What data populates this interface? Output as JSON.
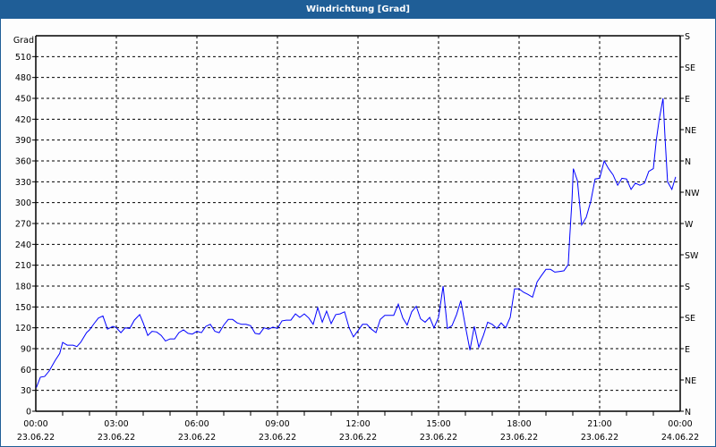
{
  "window": {
    "title": "Windrichtung [Grad]"
  },
  "chart_data": {
    "type": "line",
    "title": "Windrichtung [Grad]",
    "ylabel": "Grad",
    "ylim": [
      0,
      540
    ],
    "xlim_hours": [
      0,
      24
    ],
    "grid": true,
    "y_ticks": [
      0,
      30,
      60,
      90,
      120,
      150,
      180,
      210,
      240,
      270,
      300,
      330,
      360,
      390,
      420,
      450,
      480,
      510
    ],
    "right_ticks": [
      {
        "value": 0,
        "label": "N"
      },
      {
        "value": 45,
        "label": "NE"
      },
      {
        "value": 90,
        "label": "E"
      },
      {
        "value": 135,
        "label": "SE"
      },
      {
        "value": 180,
        "label": "S"
      },
      {
        "value": 225,
        "label": "SW"
      },
      {
        "value": 270,
        "label": "W"
      },
      {
        "value": 315,
        "label": "NW"
      },
      {
        "value": 360,
        "label": "N"
      },
      {
        "value": 405,
        "label": "NE"
      },
      {
        "value": 450,
        "label": "E"
      },
      {
        "value": 495,
        "label": "SE"
      },
      {
        "value": 540,
        "label": "S"
      }
    ],
    "x_ticks": [
      {
        "hour": 0,
        "time": "00:00",
        "date": "23.06.22"
      },
      {
        "hour": 3,
        "time": "03:00",
        "date": "23.06.22"
      },
      {
        "hour": 6,
        "time": "06:00",
        "date": "23.06.22"
      },
      {
        "hour": 9,
        "time": "09:00",
        "date": "23.06.22"
      },
      {
        "hour": 12,
        "time": "12:00",
        "date": "23.06.22"
      },
      {
        "hour": 15,
        "time": "15:00",
        "date": "23.06.22"
      },
      {
        "hour": 18,
        "time": "18:00",
        "date": "23.06.22"
      },
      {
        "hour": 21,
        "time": "21:00",
        "date": "23.06.22"
      },
      {
        "hour": 24,
        "time": "00:00",
        "date": "24.06.22"
      }
    ],
    "series": [
      {
        "name": "Windrichtung",
        "color": "#0000ff",
        "x_hours": [
          0.02,
          0.17,
          0.33,
          0.5,
          0.72,
          0.89,
          1.0,
          1.17,
          1.39,
          1.53,
          1.67,
          1.89,
          2.0,
          2.17,
          2.33,
          2.5,
          2.67,
          2.87,
          3.0,
          3.17,
          3.33,
          3.5,
          3.67,
          3.87,
          4.0,
          4.17,
          4.33,
          4.5,
          4.67,
          4.83,
          5.0,
          5.17,
          5.33,
          5.5,
          5.67,
          5.83,
          6.0,
          6.17,
          6.33,
          6.5,
          6.67,
          6.83,
          7.0,
          7.17,
          7.33,
          7.5,
          7.67,
          7.83,
          8.0,
          8.17,
          8.33,
          8.5,
          8.67,
          8.83,
          9.0,
          9.17,
          9.33,
          9.5,
          9.67,
          9.83,
          10.0,
          10.17,
          10.33,
          10.5,
          10.67,
          10.83,
          11.0,
          11.17,
          11.33,
          11.5,
          11.67,
          11.83,
          12.0,
          12.17,
          12.33,
          12.5,
          12.67,
          12.83,
          13.0,
          13.33,
          13.5,
          13.67,
          13.83,
          14.0,
          14.17,
          14.33,
          14.5,
          14.67,
          14.83,
          15.0,
          15.17,
          15.33,
          15.5,
          15.67,
          15.83,
          16.0,
          16.17,
          16.33,
          16.5,
          16.67,
          16.83,
          17.0,
          17.17,
          17.33,
          17.5,
          17.67,
          17.83,
          18.0,
          18.17,
          18.33,
          18.5,
          18.67,
          18.83,
          19.0,
          19.17,
          19.33,
          19.5,
          19.67,
          19.83,
          19.89,
          19.97,
          20.02,
          20.17,
          20.33,
          20.5,
          20.67,
          20.83,
          21.0,
          21.17,
          21.33,
          21.5,
          21.67,
          21.83,
          22.0,
          22.17,
          22.33,
          22.5,
          22.67,
          22.83,
          23.0,
          23.11,
          23.22,
          23.36,
          23.44,
          23.53,
          23.69,
          23.83
        ],
        "values": [
          34,
          49,
          50,
          58,
          73,
          83,
          99,
          95,
          95,
          93,
          99,
          113,
          117,
          126,
          134,
          137,
          118,
          122,
          120,
          113,
          120,
          119,
          131,
          139,
          127,
          109,
          115,
          114,
          109,
          101,
          104,
          104,
          113,
          117,
          112,
          111,
          115,
          113,
          122,
          125,
          115,
          113,
          124,
          132,
          132,
          127,
          125,
          125,
          123,
          112,
          111,
          120,
          118,
          121,
          119,
          130,
          131,
          131,
          140,
          135,
          140,
          134,
          125,
          149,
          128,
          144,
          126,
          139,
          140,
          143,
          120,
          107,
          116,
          125,
          125,
          118,
          113,
          132,
          138,
          138,
          154,
          134,
          124,
          143,
          151,
          133,
          128,
          135,
          120,
          135,
          180,
          119,
          123,
          139,
          159,
          122,
          88,
          122,
          92,
          109,
          128,
          125,
          119,
          127,
          120,
          135,
          176,
          176,
          171,
          168,
          164,
          186,
          195,
          204,
          204,
          200,
          201,
          202,
          211,
          253,
          304,
          349,
          332,
          268,
          279,
          302,
          334,
          335,
          360,
          349,
          340,
          325,
          335,
          334,
          319,
          328,
          325,
          328,
          345,
          349,
          390,
          420,
          450,
          390,
          330,
          319,
          337
        ]
      }
    ]
  }
}
